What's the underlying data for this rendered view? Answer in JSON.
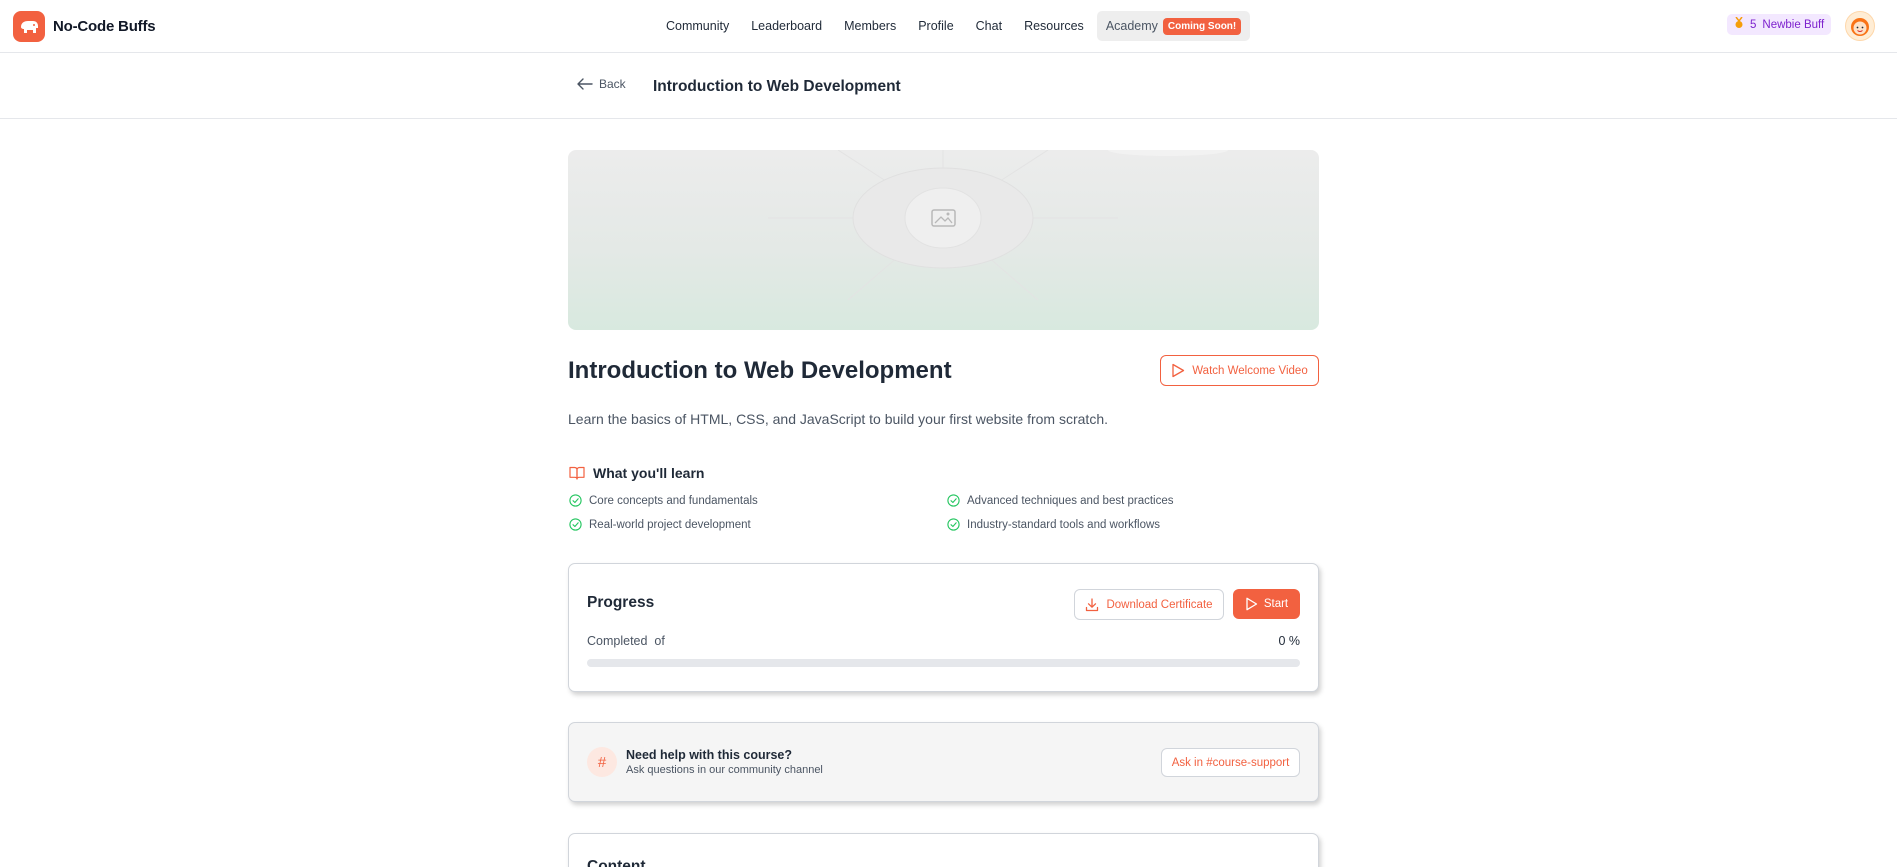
{
  "app": {
    "name": "No-Code Buffs"
  },
  "nav": {
    "items": [
      "Community",
      "Leaderboard",
      "Members",
      "Profile",
      "Chat",
      "Resources"
    ],
    "academy_label": "Academy",
    "academy_badge": "Coming Soon!"
  },
  "user": {
    "points": "5",
    "rank": "Newbie Buff"
  },
  "subheader": {
    "back_label": "Back",
    "title": "Introduction to Web Development"
  },
  "course": {
    "title": "Introduction to Web Development",
    "description": "Learn the basics of HTML, CSS, and JavaScript to build your first website from scratch.",
    "watch_label": "Watch Welcome Video"
  },
  "learn": {
    "heading": "What you'll learn",
    "items": [
      "Core concepts and fundamentals",
      "Advanced techniques and best practices",
      "Real-world project development",
      "Industry-standard tools and workflows"
    ]
  },
  "progress": {
    "title": "Progress",
    "download_label": "Download Certificate",
    "start_label": "Start",
    "completed_label": "Completed  of",
    "percent_text": "0 %",
    "percent_value": 0
  },
  "help": {
    "title": "Need help with this course?",
    "subtitle": "Ask questions in our community channel",
    "button_label": "Ask in #course-support",
    "icon_glyph": "#"
  },
  "content": {
    "title": "Content"
  },
  "colors": {
    "accent": "#f26140",
    "check": "#22c55e",
    "badge_bg": "#f3e8ff",
    "badge_text": "#7e22ce"
  }
}
